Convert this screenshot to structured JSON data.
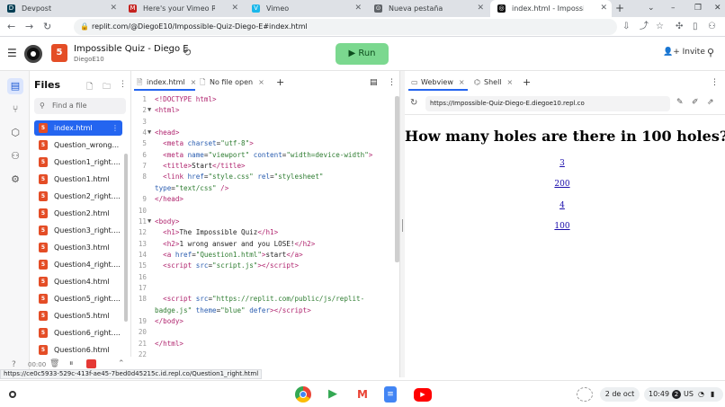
{
  "browser": {
    "tabs": [
      {
        "title": "Devpost",
        "favicon": "D",
        "color": "#003e54"
      },
      {
        "title": "Here's your Vimeo Record insi",
        "favicon": "M",
        "color": "#c5221f"
      },
      {
        "title": "Vimeo",
        "favicon": "V",
        "color": "#1ab7ea"
      },
      {
        "title": "Nueva pestaña",
        "favicon": "⊙",
        "color": "#5f6368"
      },
      {
        "title": "index.html - Impossible Q",
        "favicon": "◎",
        "color": "#111111"
      }
    ],
    "url": "replit.com/@DiegoE10/Impossible-Quiz-Diego-E#index.html",
    "status_url": "https://ce0c5933-529c-413f-ae45-7bed0d45215c.id.repl.co/Question1_right.html"
  },
  "replit": {
    "project_name": "Impossible Quiz - Diego E.",
    "username": "DiegoE10",
    "run_label": "Run",
    "invite_label": "Invite"
  },
  "files": {
    "title": "Files",
    "search_placeholder": "Find a file",
    "items": [
      "index.html",
      "Question_wrong...",
      "Question1_right....",
      "Question1.html",
      "Question2_right....",
      "Question2.html",
      "Question3_right....",
      "Question3.html",
      "Question4_right....",
      "Question4.html",
      "Question5_right....",
      "Question5.html",
      "Question6_right....",
      "Question6.html"
    ],
    "bottom_time": "00:00"
  },
  "editor": {
    "tabs": [
      "index.html",
      "No file open"
    ],
    "lines": [
      {
        "n": "1",
        "fold": "",
        "html": "<span class='tg'>&lt;!DOCTYPE html&gt;</span>"
      },
      {
        "n": "2",
        "fold": "▼",
        "html": "<span class='tg'>&lt;html&gt;</span>"
      },
      {
        "n": "3",
        "fold": "",
        "html": ""
      },
      {
        "n": "4",
        "fold": "▼",
        "html": "<span class='tg'>&lt;head&gt;</span>"
      },
      {
        "n": "5",
        "fold": "",
        "html": "  <span class='tg'>&lt;meta</span> <span class='at'>charset</span>=<span class='st'>\"utf-8\"</span><span class='tg'>&gt;</span>"
      },
      {
        "n": "6",
        "fold": "",
        "html": "  <span class='tg'>&lt;meta</span> <span class='at'>name</span>=<span class='st'>\"viewport\"</span> <span class='at'>content</span>=<span class='st'>\"width=device-width\"</span><span class='tg'>&gt;</span>"
      },
      {
        "n": "7",
        "fold": "",
        "html": "  <span class='tg'>&lt;title&gt;</span>Start<span class='tg'>&lt;/title&gt;</span>"
      },
      {
        "n": "8",
        "fold": "",
        "html": "  <span class='tg'>&lt;link</span> <span class='at'>href</span>=<span class='st'>\"style.css\"</span> <span class='at'>rel</span>=<span class='st'>\"stylesheet\"</span>"
      },
      {
        "n": "",
        "fold": "",
        "html": "<span class='at'>type</span>=<span class='st'>\"text/css\"</span> <span class='tg'>/&gt;</span>"
      },
      {
        "n": "9",
        "fold": "",
        "html": "<span class='tg'>&lt;/head&gt;</span>"
      },
      {
        "n": "10",
        "fold": "",
        "html": ""
      },
      {
        "n": "11",
        "fold": "▼",
        "html": "<span class='tg'>&lt;body&gt;</span>"
      },
      {
        "n": "12",
        "fold": "",
        "html": "  <span class='tg'>&lt;h1&gt;</span>The Impossible Quiz<span class='tg'>&lt;/h1&gt;</span>"
      },
      {
        "n": "13",
        "fold": "",
        "html": "  <span class='tg'>&lt;h2&gt;</span>1 wrong answer and you LOSE!<span class='tg'>&lt;/h2&gt;</span>"
      },
      {
        "n": "14",
        "fold": "",
        "html": "  <span class='tg'>&lt;a</span> <span class='at'>href</span>=<span class='st'>\"Question1.html\"</span><span class='tg'>&gt;</span>start<span class='tg'>&lt;/a&gt;</span>"
      },
      {
        "n": "15",
        "fold": "",
        "html": "  <span class='tg'>&lt;script</span> <span class='at'>src</span>=<span class='st'>\"script.js\"</span><span class='tg'>&gt;&lt;/script&gt;</span>"
      },
      {
        "n": "16",
        "fold": "",
        "html": ""
      },
      {
        "n": "17",
        "fold": "",
        "html": ""
      },
      {
        "n": "18",
        "fold": "",
        "html": "  <span class='tg'>&lt;script</span> <span class='at'>src</span>=<span class='st'>\"https://replit.com/public/js/replit-</span>"
      },
      {
        "n": "",
        "fold": "",
        "html": "<span class='st'>badge.js\"</span> <span class='at'>theme</span>=<span class='st'>\"blue\"</span> <span class='at'>defer</span><span class='tg'>&gt;&lt;/script&gt;</span>"
      },
      {
        "n": "19",
        "fold": "",
        "html": "<span class='tg'>&lt;/body&gt;</span>"
      },
      {
        "n": "20",
        "fold": "",
        "html": ""
      },
      {
        "n": "21",
        "fold": "",
        "html": "<span class='tg'>&lt;/html&gt;</span>"
      },
      {
        "n": "22",
        "fold": "",
        "html": ""
      }
    ]
  },
  "webview": {
    "tabs": [
      "Webview",
      "Shell"
    ],
    "url": "https://Impossible-Quiz-Diego-E.diegoe10.repl.co",
    "question": "How many holes are there in 100 holes?",
    "answers": [
      "3",
      "200",
      "4",
      "100"
    ]
  },
  "shelf": {
    "date": "2 de oct",
    "time": "10:49",
    "locale": "US",
    "notif_count": "2"
  }
}
